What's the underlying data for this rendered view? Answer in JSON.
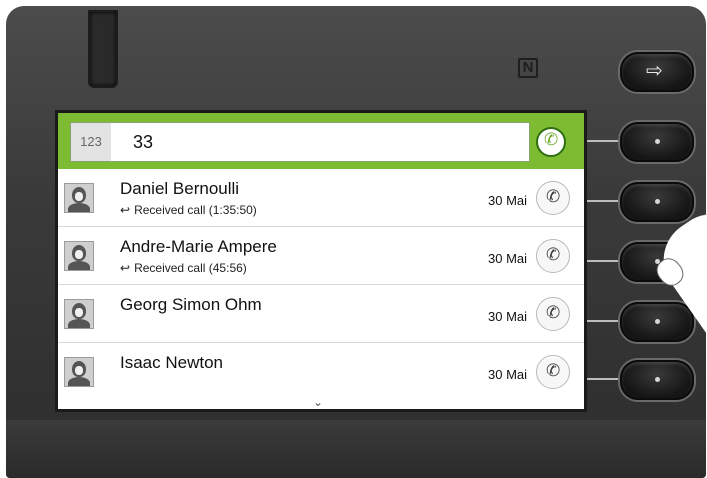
{
  "dialer": {
    "mode_label": "123",
    "number": "33",
    "call_icon": "phone-icon"
  },
  "hardware": {
    "exit_icon": "exit-icon",
    "nfc_label": "N"
  },
  "entries": [
    {
      "name": "Daniel Bernoulli",
      "detail": "Received call (1:35:50)",
      "date": "30 Mai"
    },
    {
      "name": "Andre-Marie Ampere",
      "detail": "Received call (45:56)",
      "date": "30 Mai"
    },
    {
      "name": "Georg Simon Ohm",
      "detail": "",
      "date": "30 Mai"
    },
    {
      "name": "Isaac Newton",
      "detail": "",
      "date": "30 Mai"
    }
  ],
  "glyphs": {
    "received": "↩",
    "phone": "✆",
    "chevron": "⌄",
    "exit": "⇨"
  }
}
